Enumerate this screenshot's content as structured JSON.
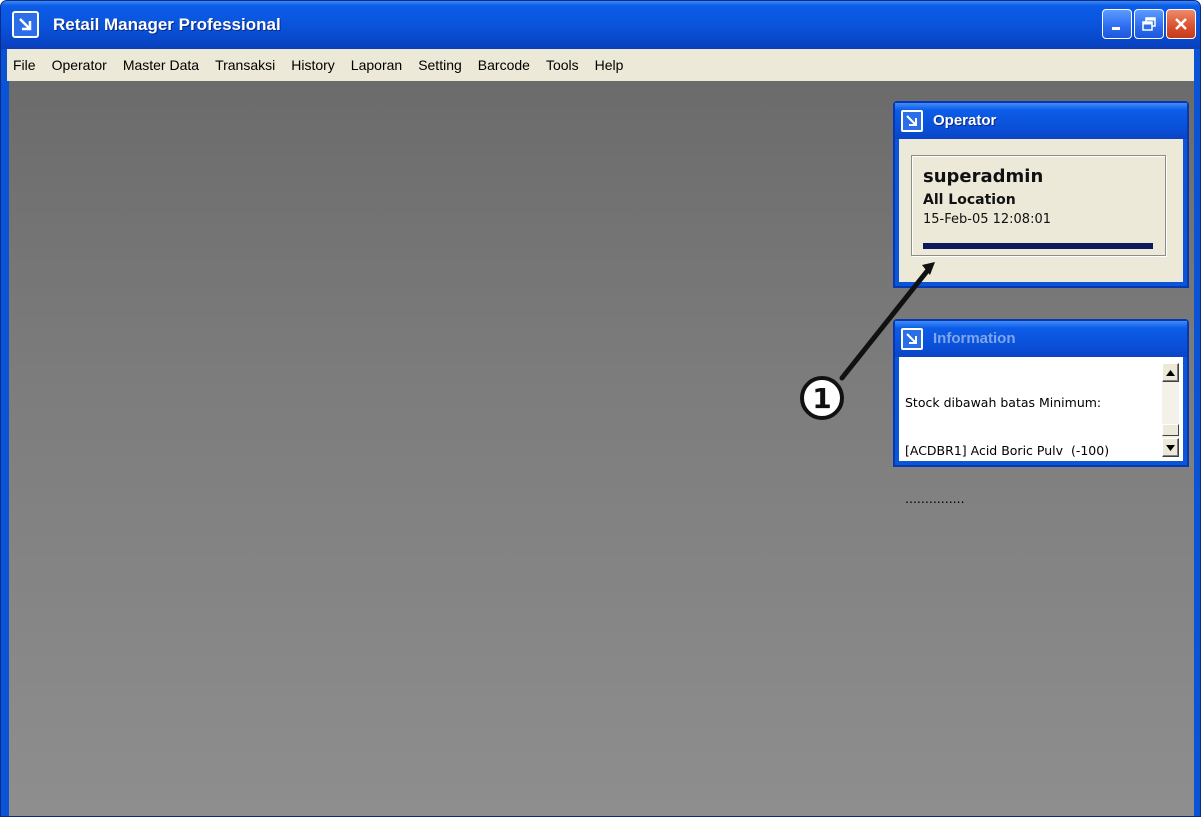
{
  "window": {
    "title": "Retail Manager Professional"
  },
  "menu": [
    {
      "label": "File"
    },
    {
      "label": "Operator"
    },
    {
      "label": "Master Data"
    },
    {
      "label": "Transaksi"
    },
    {
      "label": "History"
    },
    {
      "label": "Laporan"
    },
    {
      "label": "Setting"
    },
    {
      "label": "Barcode"
    },
    {
      "label": "Tools"
    },
    {
      "label": "Help"
    }
  ],
  "operator_panel": {
    "title": "Operator",
    "username": "superadmin",
    "location": "All Location",
    "datetime": "15-Feb-05 12:08:01",
    "progress_fraction": 1.0
  },
  "information_panel": {
    "title": "Information",
    "lines": [
      "Stock dibawah batas Minimum:",
      "[ACDBR1] Acid Boric Pulv  (-100)",
      "..............."
    ]
  },
  "callout": {
    "number": "1"
  },
  "colors": {
    "titlebar": "#0a54dc",
    "menubar": "#ece9d8",
    "workspace": "#7c7c7c",
    "panel_border": "#0a55d8",
    "progress_fill": "#0a1a5c"
  },
  "icons": {
    "app": "arrow-down-right-icon",
    "minimize": "minimize-icon",
    "maximize": "restore-icon",
    "close": "close-icon"
  }
}
